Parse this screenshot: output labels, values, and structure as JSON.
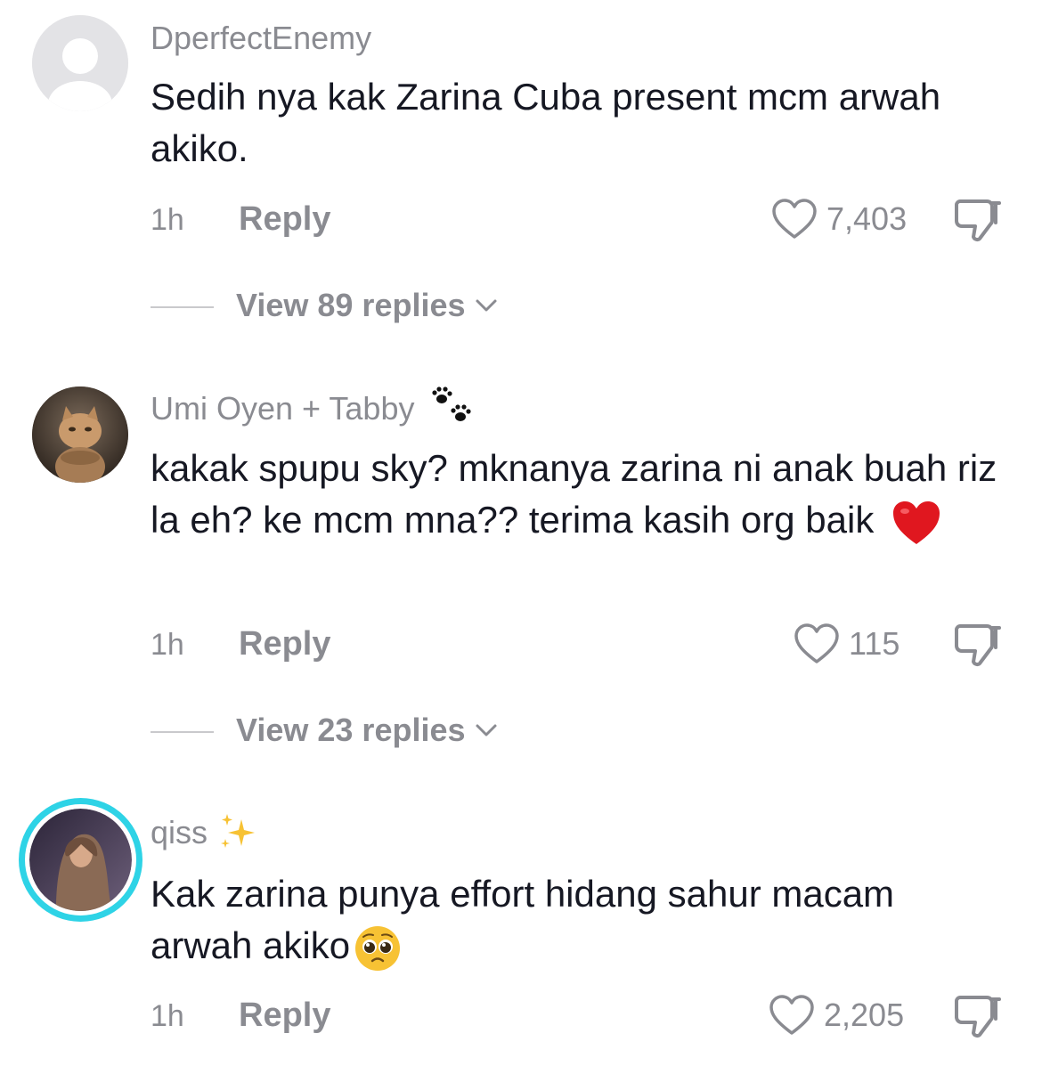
{
  "comments": [
    {
      "username": "DperfectEnemy",
      "text": "Sedih nya kak Zarina Cuba present mcm arwah akiko.",
      "time": "1h",
      "reply_label": "Reply",
      "likes": "7,403",
      "view_replies": "View 89 replies"
    },
    {
      "username": "Umi Oyen + Tabby",
      "username_emoji": "paw-prints-icon",
      "text": "kakak spupu sky? mknanya zarina ni anak buah riz la eh? ke mcm mna?? terima kasih org baik",
      "text_emoji": "red-heart-icon",
      "time": "1h",
      "reply_label": "Reply",
      "likes": "115",
      "view_replies": "View 23 replies"
    },
    {
      "username": "qiss",
      "username_emoji": "sparkles-icon",
      "text": "Kak zarina punya effort hidang sahur macam arwah akiko",
      "text_emoji": "pleading-face-icon",
      "time": "1h",
      "reply_label": "Reply",
      "likes": "2,205"
    }
  ],
  "colors": {
    "text_primary": "#161823",
    "text_secondary": "#8a8b91",
    "story_ring": "#2ed3e6"
  }
}
